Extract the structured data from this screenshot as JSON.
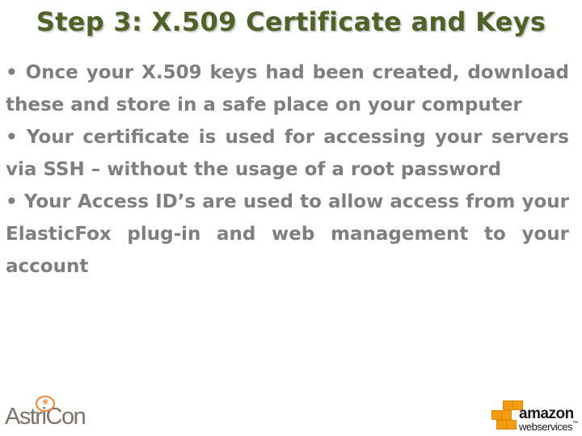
{
  "slide": {
    "title": "Step 3: X.509 Certificate and Keys",
    "bullets": [
      "• Once your X.509 keys had been created, download these and store in a safe place on your computer",
      "• Your certificate is used for accessing your servers via SSH – without the usage of a root password",
      "• Your Access ID’s are used to allow access from your ElasticFox plug-in and web management to your account"
    ]
  },
  "logos": {
    "left": {
      "text": "AstriCon",
      "icon": "asterisk-icon"
    },
    "right": {
      "line1": "amazon",
      "line2": "webservices",
      "tm": "™"
    }
  },
  "colors": {
    "title": "#4f6228",
    "body": "#7f7f7f",
    "astricon_accent": "#f0873a",
    "aws_orange": "#f39c12"
  }
}
